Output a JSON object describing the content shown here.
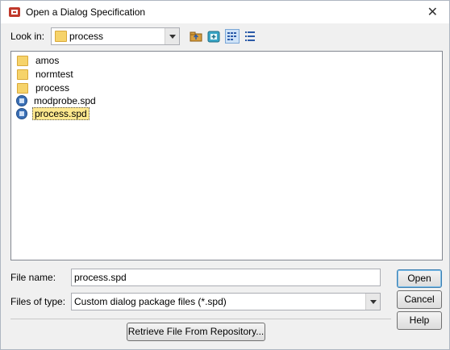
{
  "window": {
    "title": "Open a Dialog Specification"
  },
  "lookin": {
    "label": "Look in:",
    "accesskey_label": "Look ",
    "rest_label": "in:",
    "value": "process"
  },
  "toolbar": {
    "icons": [
      "up-folder-icon",
      "new-folder-icon",
      "list-view-icon",
      "details-view-icon"
    ]
  },
  "files": [
    {
      "name": "amos",
      "type": "folder"
    },
    {
      "name": "normtest",
      "type": "folder"
    },
    {
      "name": "process",
      "type": "folder"
    },
    {
      "name": "modprobe.spd",
      "type": "spd"
    },
    {
      "name": "process.spd",
      "type": "spd",
      "selected": true
    }
  ],
  "filename": {
    "label": "File name:",
    "value": "process.spd"
  },
  "filetype": {
    "label": "Files of type:",
    "value": "Custom dialog package files (*.spd)"
  },
  "buttons": {
    "open": "Open",
    "cancel": "Cancel",
    "help": "Help",
    "retrieve": "Retrieve File From Repository..."
  }
}
